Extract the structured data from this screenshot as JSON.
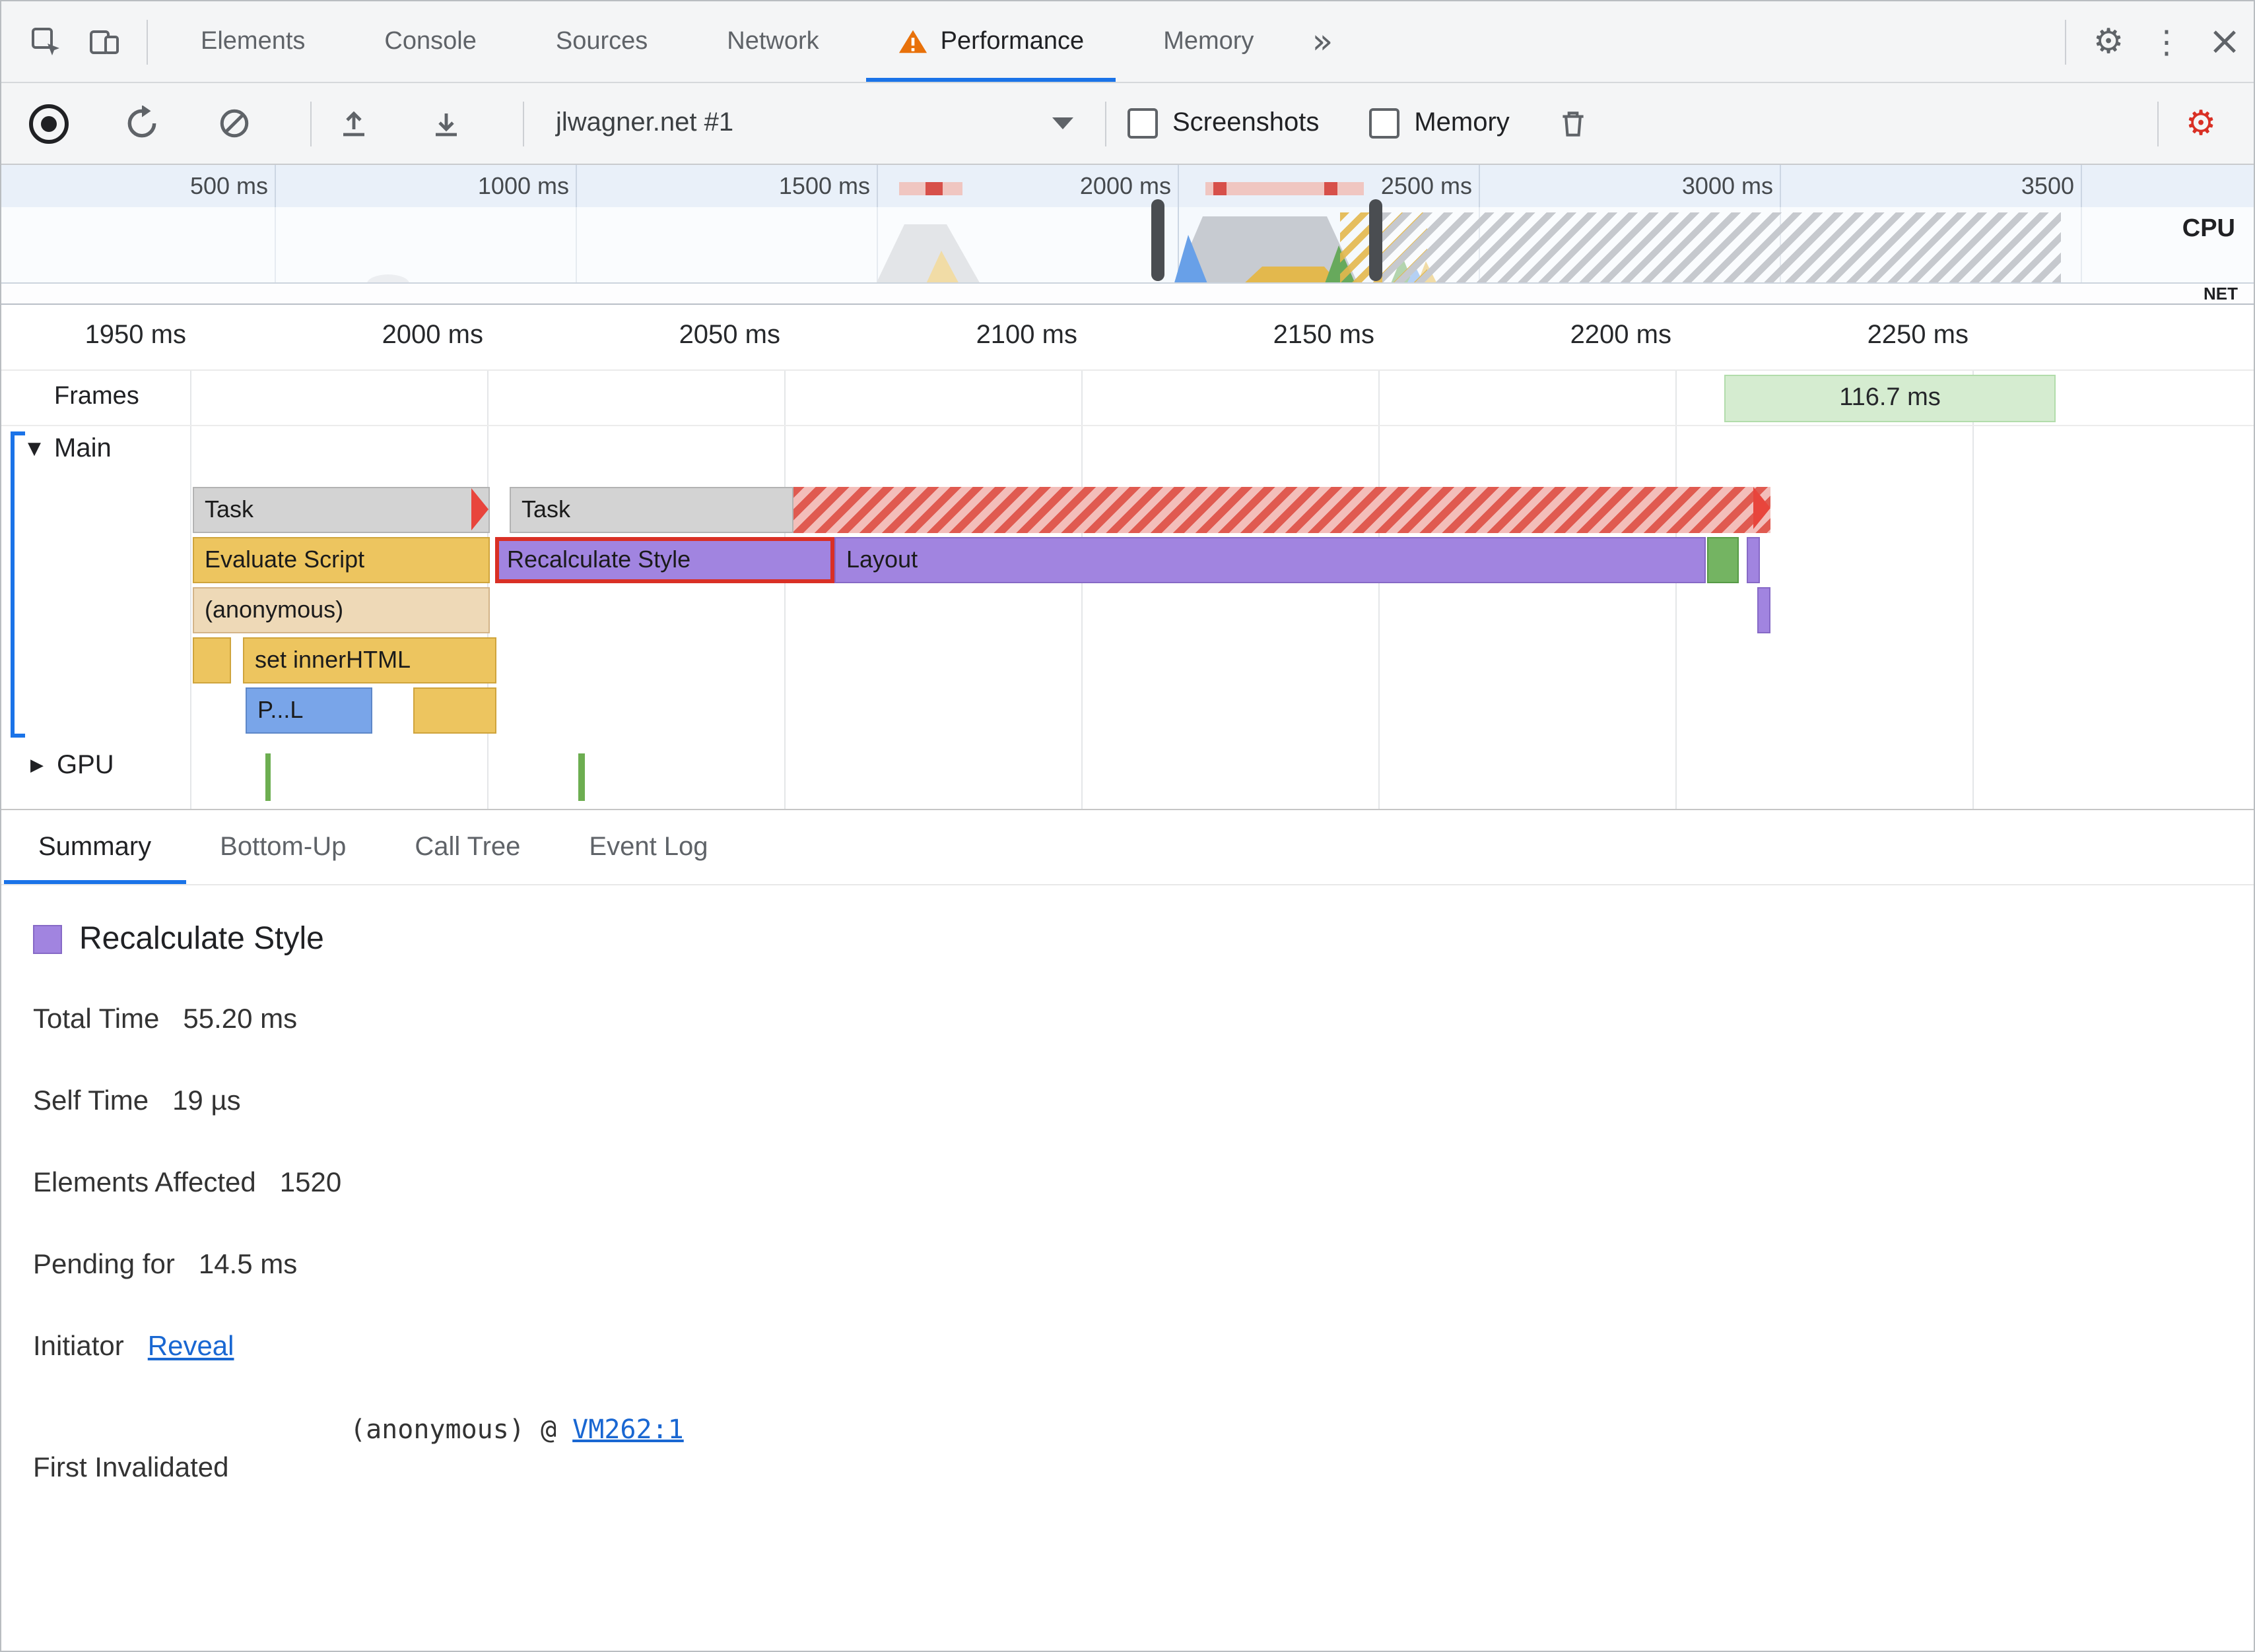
{
  "devtools_tabs": {
    "items": [
      "Elements",
      "Console",
      "Sources",
      "Network",
      "Performance",
      "Memory"
    ]
  },
  "toolbar": {
    "history_dropdown": "jlwagner.net #1",
    "screenshots_label": "Screenshots",
    "memory_label": "Memory"
  },
  "overview": {
    "ruler_labels": [
      "500 ms",
      "1000 ms",
      "1500 ms",
      "2000 ms",
      "2500 ms",
      "3000 ms",
      "3500"
    ],
    "cpu_label": "CPU",
    "net_label": "NET"
  },
  "detail_ruler": [
    "1950 ms",
    "2000 ms",
    "2050 ms",
    "2100 ms",
    "2150 ms",
    "2200 ms",
    "2250 ms"
  ],
  "frames": {
    "label": "Frames",
    "frame_duration": "116.7 ms"
  },
  "tracks": {
    "main_label": "Main",
    "gpu_label": "GPU",
    "bars": {
      "task1": "Task",
      "task2": "Task",
      "evaluate_script": "Evaluate Script",
      "recalculate_style": "Recalculate Style",
      "layout": "Layout",
      "anonymous": "(anonymous)",
      "set_inner_html": "set innerHTML",
      "parse_html": "P...L"
    }
  },
  "bottom_tabs": [
    "Summary",
    "Bottom-Up",
    "Call Tree",
    "Event Log"
  ],
  "summary": {
    "title": "Recalculate Style",
    "rows": [
      {
        "label": "Total Time",
        "value": "55.20 ms"
      },
      {
        "label": "Self Time",
        "value": "19 µs"
      },
      {
        "label": "Elements Affected",
        "value": "1520"
      },
      {
        "label": "Pending for",
        "value": "14.5 ms"
      }
    ],
    "initiator_label": "Initiator",
    "initiator_link": "Reveal",
    "first_invalidated_label": "First Invalidated",
    "first_invalidated_value": "(anonymous) @ ",
    "first_invalidated_link": "VM262:1"
  },
  "colors": {
    "accent": "#1a73e8",
    "selection_red": "#d93025",
    "scripting_yellow": "#edc55f",
    "rendering_purple": "#a184e0",
    "painting_green": "#74b462",
    "task_gray": "#d3d3d3",
    "link_blue": "#1967d2"
  }
}
